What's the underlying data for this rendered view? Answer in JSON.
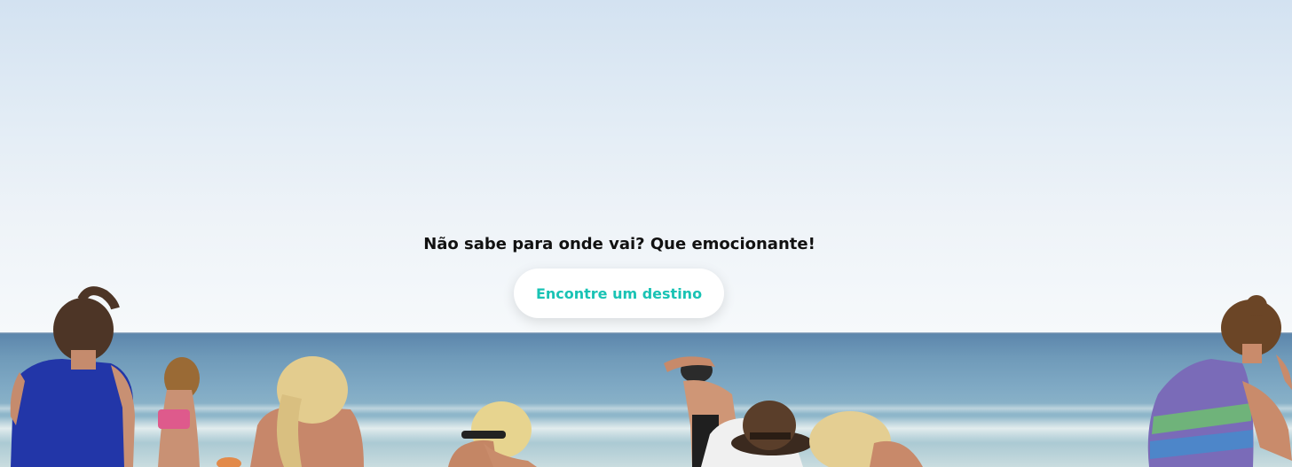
{
  "hero": {
    "heading": "Não sabe para onde vai? Que emocionante!",
    "button_label": "Encontre um destino"
  },
  "colors": {
    "accent": "#19c3b4",
    "heading": "#111111",
    "button_bg": "#ffffff"
  }
}
